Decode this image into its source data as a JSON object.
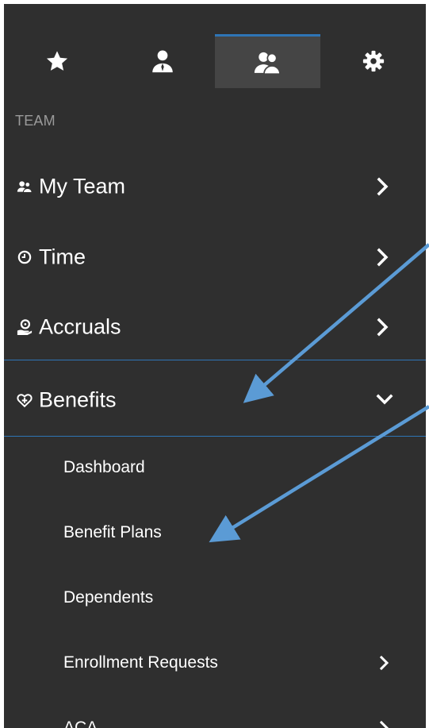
{
  "tabs": [
    {
      "icon": "star-icon",
      "active": false
    },
    {
      "icon": "person-icon",
      "active": false
    },
    {
      "icon": "team-icon",
      "active": true
    },
    {
      "icon": "gear-icon",
      "active": false
    }
  ],
  "section_label": "TEAM",
  "nav": {
    "my_team": {
      "label": "My Team",
      "icon": "people-icon"
    },
    "time": {
      "label": "Time",
      "icon": "clock-icon"
    },
    "accruals": {
      "label": "Accruals",
      "icon": "hand-coin-icon"
    },
    "benefits": {
      "label": "Benefits",
      "icon": "heart-plus-icon",
      "expanded": true
    }
  },
  "benefits_sub": {
    "dashboard": "Dashboard",
    "benefit_plans": "Benefit Plans",
    "dependents": "Dependents",
    "enrollment_requests": "Enrollment Requests",
    "aca": "ACA"
  },
  "colors": {
    "panel_bg": "#2f2f2f",
    "active_tab_bg": "#454545",
    "accent": "#2e75b6",
    "annotation_arrow": "#5b9bd5",
    "text": "#ffffff",
    "muted_text": "#9a9a9a"
  }
}
